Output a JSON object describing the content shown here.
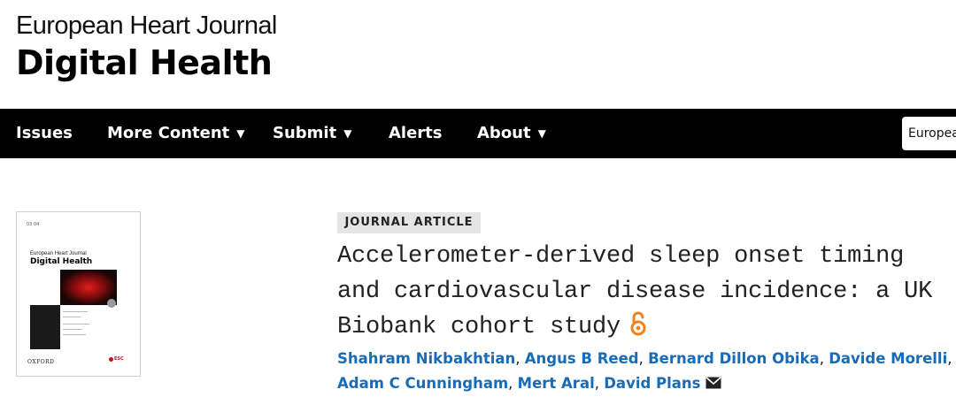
{
  "journal": {
    "line1": "European Heart Journal",
    "line2": "Digital Health"
  },
  "nav": {
    "items": [
      {
        "label": "Issues",
        "has_dropdown": false
      },
      {
        "label": "More Content",
        "has_dropdown": true
      },
      {
        "label": "Submit",
        "has_dropdown": true
      },
      {
        "label": "Alerts",
        "has_dropdown": false
      },
      {
        "label": "About",
        "has_dropdown": true
      }
    ],
    "dropdown_caret": "▼",
    "search_scope": "European"
  },
  "cover": {
    "volume": "03 04",
    "title_line1": "European Heart Journal",
    "title_line2": "Digital Health",
    "publisher": "OXFORD",
    "society": "ESC"
  },
  "article": {
    "type_badge": "JOURNAL ARTICLE",
    "title": "Accelerometer-derived sleep onset timing and cardiovascular disease incidence: a UK Biobank cohort study",
    "open_access_icon": "open-access-icon",
    "authors": [
      "Shahram Nikbakhtian",
      "Angus B Reed",
      "Bernard Dillon Obika",
      "Davide Morelli",
      "Adam C Cunningham",
      "Mert Aral",
      "David Plans"
    ],
    "author_separator": ", ",
    "contact_icon": "envelope-icon"
  },
  "colors": {
    "nav_background": "#000000",
    "badge_background": "#e5e5e5",
    "author_link": "#1a6bb5",
    "open_access": "#f0821e"
  }
}
